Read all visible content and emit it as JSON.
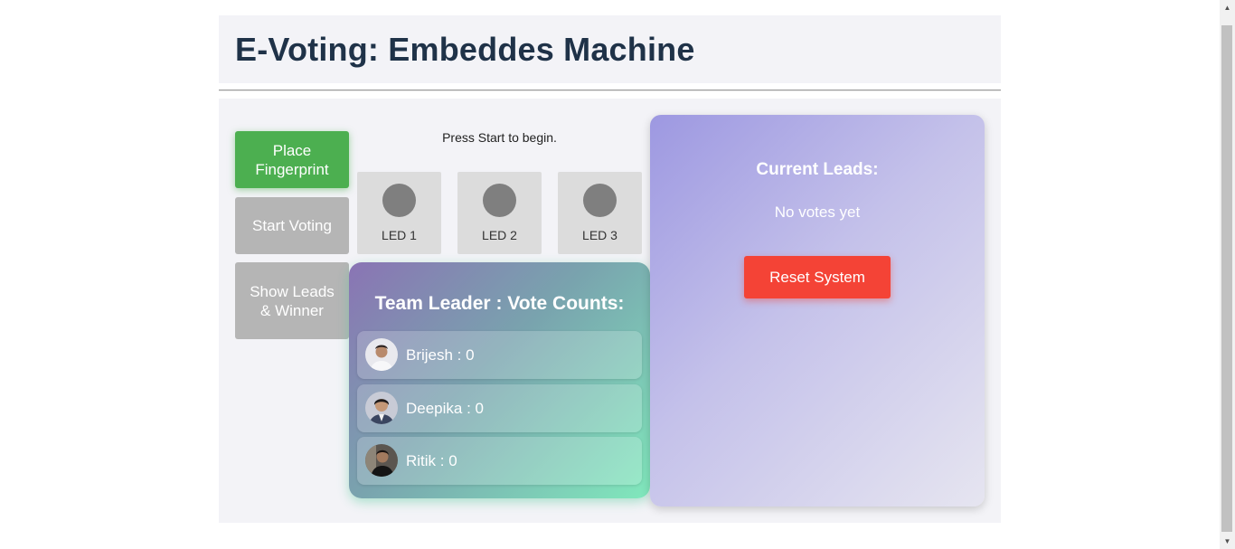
{
  "header": {
    "title": "E-Voting: Embeddes Machine"
  },
  "controls": {
    "place_fingerprint": "Place Fingerprint",
    "start_voting": "Start Voting",
    "show_leads": "Show Leads & Winner"
  },
  "status_text": "Press Start to begin.",
  "leds": [
    {
      "label": "LED 1"
    },
    {
      "label": "LED 2"
    },
    {
      "label": "LED 3"
    }
  ],
  "vote_counts": {
    "title": "Team Leader : Vote Counts:",
    "candidates": [
      {
        "text": "Brijesh : 0"
      },
      {
        "text": "Deepika : 0"
      },
      {
        "text": "Ritik : 0"
      }
    ]
  },
  "leads": {
    "title": "Current Leads:",
    "message": "No votes yet",
    "reset_label": "Reset System"
  },
  "colors": {
    "title": "#1f3248",
    "primary_green": "#4caf50",
    "disabled_grey": "#b5b5b5",
    "reset_red": "#f44336",
    "led_off": "#7f7f7f"
  },
  "icons": [
    "scroll-up-arrow-icon",
    "scroll-down-arrow-icon"
  ]
}
